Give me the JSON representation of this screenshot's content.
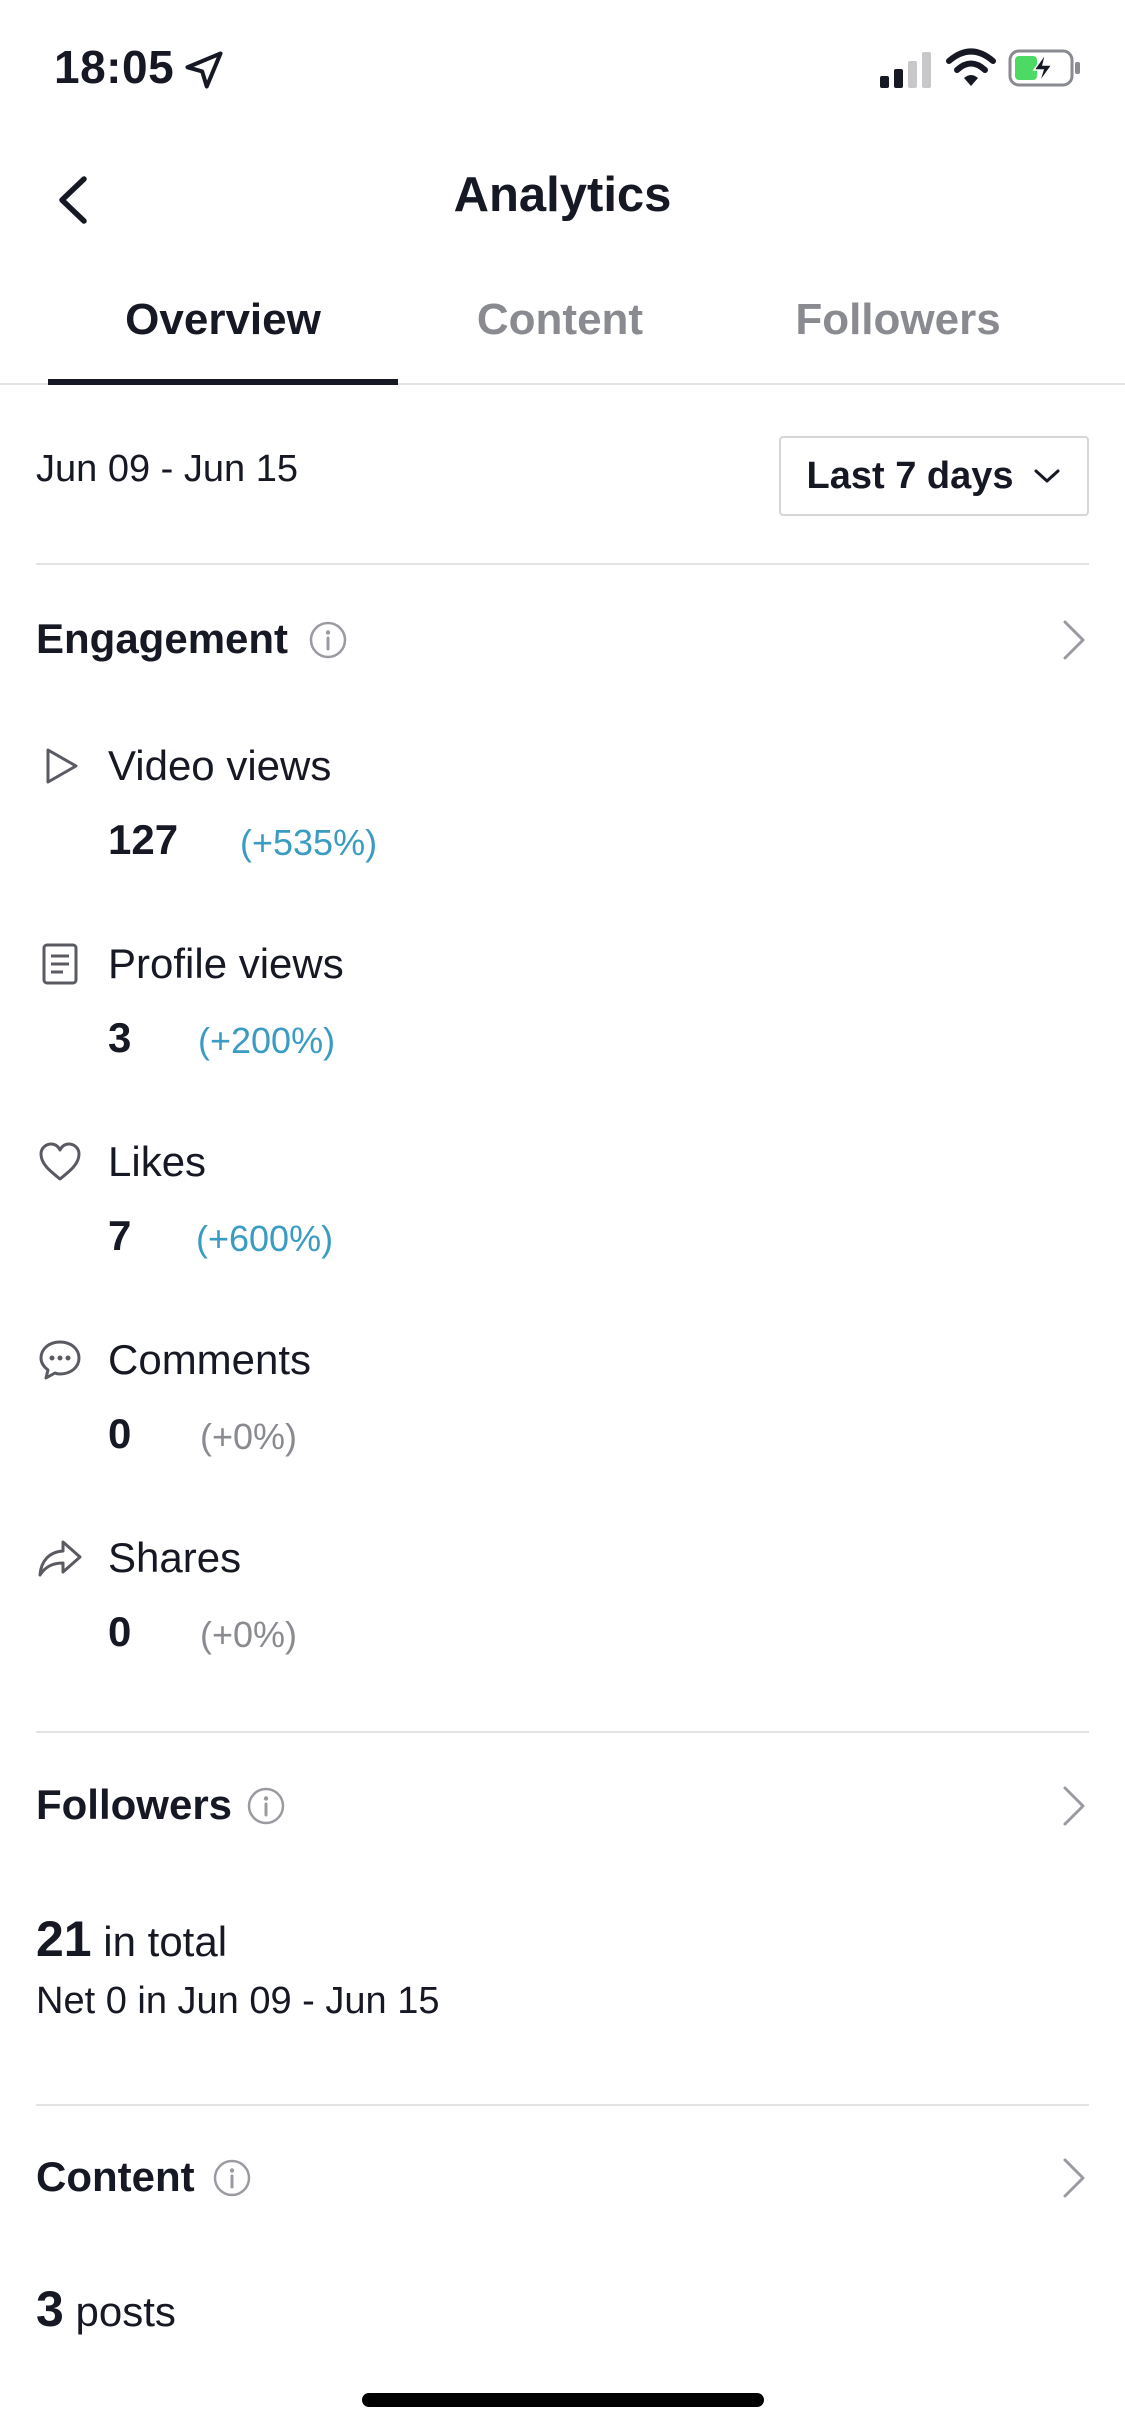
{
  "status_bar": {
    "time": "18:05"
  },
  "header": {
    "title": "Analytics"
  },
  "tabs": [
    {
      "label": "Overview",
      "active": true
    },
    {
      "label": "Content",
      "active": false
    },
    {
      "label": "Followers",
      "active": false
    }
  ],
  "date_row": {
    "date_range": "Jun 09 - Jun 15",
    "range_select": "Last 7 days"
  },
  "engagement": {
    "title": "Engagement",
    "metrics": [
      {
        "icon": "play-icon",
        "label": "Video views",
        "value": "127",
        "change": "(+535%)"
      },
      {
        "icon": "profile-icon",
        "label": "Profile views",
        "value": "3",
        "change": "(+200%)"
      },
      {
        "icon": "heart-icon",
        "label": "Likes",
        "value": "7",
        "change": "(+600%)"
      },
      {
        "icon": "comment-icon",
        "label": "Comments",
        "value": "0",
        "change": "(+0%)"
      },
      {
        "icon": "share-icon",
        "label": "Shares",
        "value": "0",
        "change": "(+0%)"
      }
    ]
  },
  "followers": {
    "title": "Followers",
    "total": "21",
    "total_suffix": " in total",
    "net": "Net 0 in Jun 09 - Jun 15"
  },
  "content": {
    "title": "Content",
    "posts": "3",
    "posts_suffix": " posts"
  },
  "colors": {
    "positive": "#3a9cc2",
    "neutral": "#8a8b91",
    "text": "#161823",
    "divider": "#e3e3e4"
  }
}
